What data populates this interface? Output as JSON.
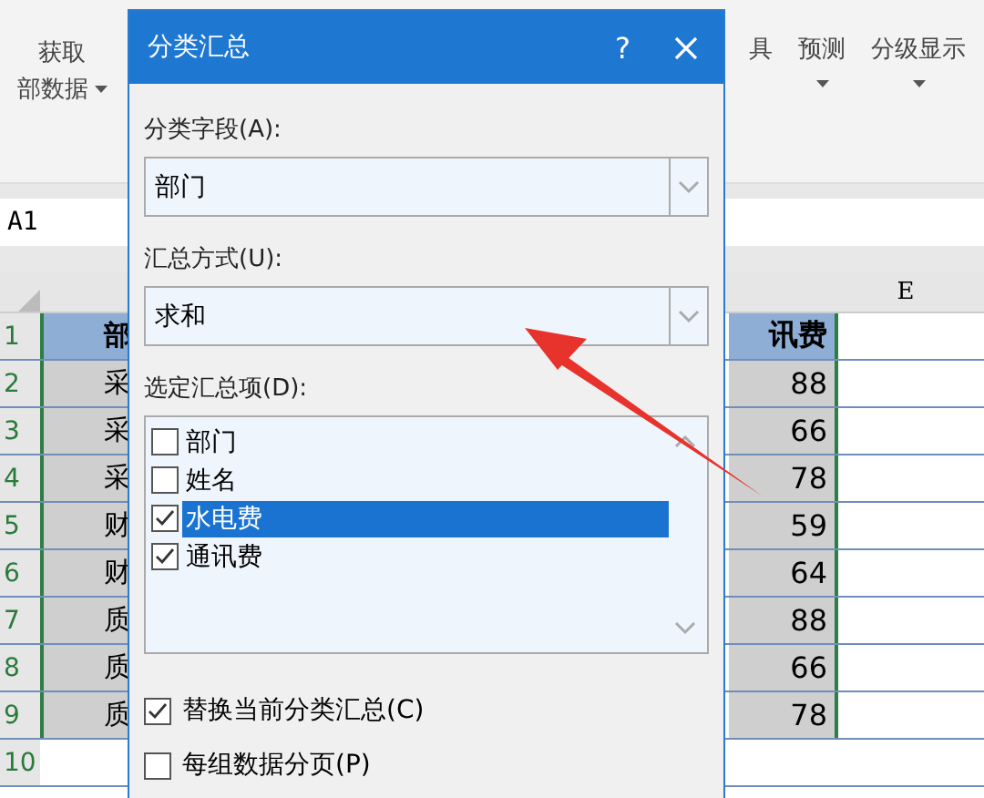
{
  "ribbon": {
    "get_data": {
      "label": "获取",
      "sublabel": "部数据",
      "dropdown": true
    },
    "groups": [
      {
        "label": "具",
        "dropdown": false
      },
      {
        "label": "预测",
        "dropdown": true
      },
      {
        "label": "分级显示",
        "dropdown": true
      }
    ]
  },
  "name_box": "A1",
  "sheet": {
    "columns": [
      {
        "label": "E"
      }
    ],
    "rows": [
      {
        "number": "1",
        "col_a": "部",
        "col_d": "讯费",
        "kind": "header"
      },
      {
        "number": "2",
        "col_a": "采",
        "col_d": "88",
        "kind": "data"
      },
      {
        "number": "3",
        "col_a": "采",
        "col_d": "66",
        "kind": "data"
      },
      {
        "number": "4",
        "col_a": "采",
        "col_d": "78",
        "kind": "data"
      },
      {
        "number": "5",
        "col_a": "财",
        "col_d": "59",
        "kind": "data"
      },
      {
        "number": "6",
        "col_a": "财",
        "col_d": "64",
        "kind": "data"
      },
      {
        "number": "7",
        "col_a": "质",
        "col_d": "88",
        "kind": "data"
      },
      {
        "number": "8",
        "col_a": "质",
        "col_d": "66",
        "kind": "data"
      },
      {
        "number": "9",
        "col_a": "质",
        "col_d": "78",
        "kind": "data"
      },
      {
        "number": "10",
        "kind": "empty"
      }
    ]
  },
  "dialog": {
    "title": "分类汇总",
    "help": "?",
    "group_by": {
      "label": "分类字段(A):",
      "value": "部门"
    },
    "function": {
      "label": "汇总方式(U):",
      "value": "求和"
    },
    "items_label": "选定汇总项(D):",
    "items": [
      {
        "label": "部门",
        "checked": false,
        "selected": false
      },
      {
        "label": "姓名",
        "checked": false,
        "selected": false
      },
      {
        "label": "水电费",
        "checked": true,
        "selected": true
      },
      {
        "label": "通讯费",
        "checked": true,
        "selected": false
      }
    ],
    "options": [
      {
        "label": "替换当前分类汇总(C)",
        "checked": true
      },
      {
        "label": "每组数据分页(P)",
        "checked": false
      }
    ]
  }
}
